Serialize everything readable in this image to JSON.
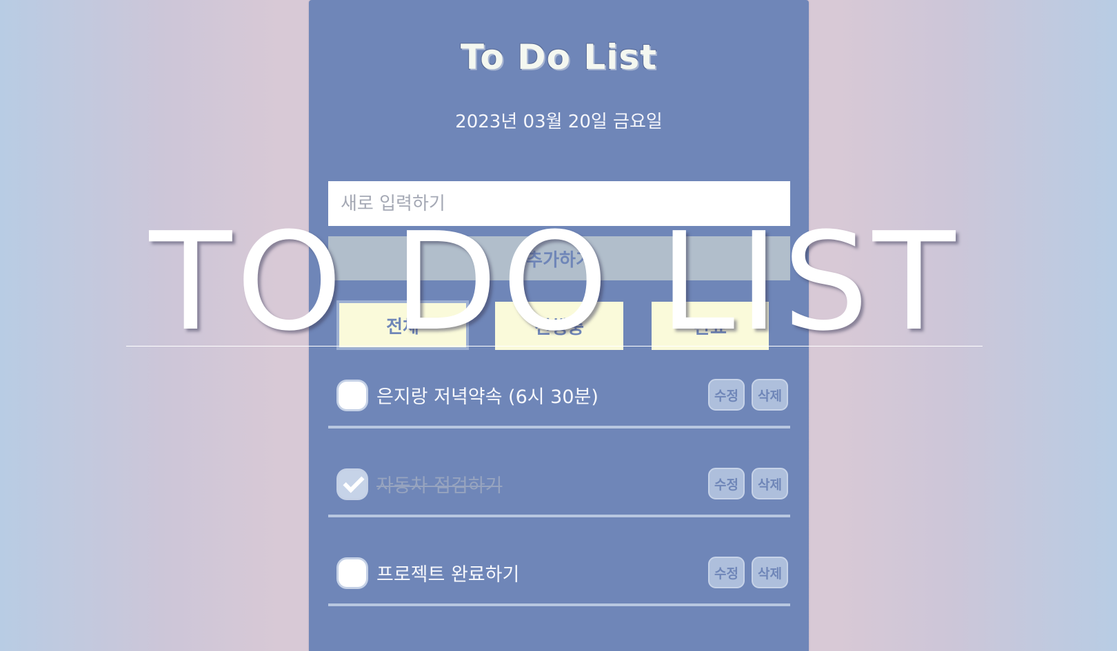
{
  "app": {
    "title": "To Do List",
    "date": "2023년 03월 20일 금요일"
  },
  "input": {
    "placeholder": "새로 입력하기",
    "value": ""
  },
  "add_button": {
    "label": "추가하기"
  },
  "filters": {
    "all": "전체",
    "in_progress": "진행중",
    "done": "완료",
    "active": "all"
  },
  "todos": [
    {
      "text": "은지랑 저녁약속 (6시 30분)",
      "done": false,
      "edit_label": "수정",
      "delete_label": "삭제"
    },
    {
      "text": "자동차 점검하기",
      "done": true,
      "edit_label": "수정",
      "delete_label": "삭제"
    },
    {
      "text": "프로젝트 완료하기",
      "done": false,
      "edit_label": "수정",
      "delete_label": "삭제"
    }
  ],
  "overlay": {
    "title": "TO DO LIST"
  },
  "colors": {
    "panel": "#6f86b8",
    "filter_bg": "#fafada",
    "add_button_bg": "#b1becb",
    "divider": "#b8c7e0",
    "background_edge": "#b8cce4",
    "background_center": "#dac8d4"
  }
}
